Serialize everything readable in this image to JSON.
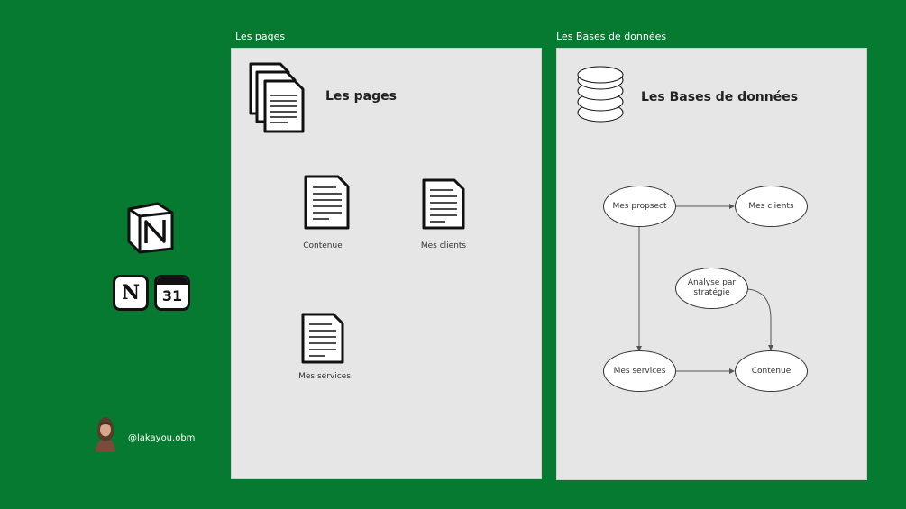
{
  "frames": {
    "pages_label": "Les pages",
    "databases_label": "Les Bases de données"
  },
  "pages_panel": {
    "title": "Les pages",
    "documents": [
      {
        "label": "Contenue"
      },
      {
        "label": "Mes clients"
      },
      {
        "label": "Mes services"
      }
    ]
  },
  "databases_panel": {
    "title": "Les Bases de données",
    "nodes": {
      "prospect": "Mes propsect",
      "clients": "Mes clients",
      "analyse": "Analyse par stratégie",
      "services": "Mes services",
      "contenue": "Contenue"
    }
  },
  "sidebar": {
    "calendar_number": "31",
    "notion_letter": "N",
    "handle": "@lakayou.obm"
  },
  "colors": {
    "background": "#057a30",
    "panel": "#e6e6e6"
  }
}
